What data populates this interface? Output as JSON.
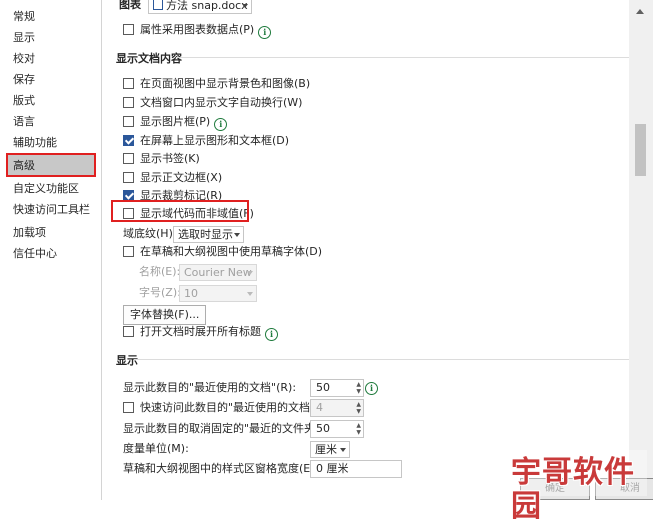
{
  "sidebar": {
    "items": [
      "常规",
      "显示",
      "校对",
      "保存",
      "版式",
      "语言",
      "辅助功能",
      "高级",
      "自定义功能区",
      "快速访问工具栏",
      "加载项",
      "信任中心"
    ],
    "selected": "高级"
  },
  "top": {
    "chart_label": "图表",
    "chart_doc": "方法 snap.docx",
    "attr_chart_points": "属性采用图表数据点(P)"
  },
  "doc_content": {
    "heading": "显示文档内容",
    "options": [
      {
        "label": "在页面视图中显示背景色和图像(B)",
        "checked": false
      },
      {
        "label": "文档窗口内显示文字自动换行(W)",
        "checked": false
      },
      {
        "label": "显示图片框(P)",
        "checked": false
      },
      {
        "label": "在屏幕上显示图形和文本框(D)",
        "checked": true
      },
      {
        "label": "显示书签(K)",
        "checked": false
      },
      {
        "label": "显示正文边框(X)",
        "checked": false
      },
      {
        "label": "显示裁剪标记(R)",
        "checked": true
      },
      {
        "label": "显示域代码而非域值(F)",
        "checked": false
      }
    ],
    "field_shading_label": "域底纹(H):",
    "field_shading_value": "选取时显示",
    "draft_font_label": "在草稿和大纲视图中使用草稿字体(D)",
    "name_label": "名称(E):",
    "name_value": "Courier New",
    "size_label": "字号(Z):",
    "size_value": "10",
    "font_sub_button": "字体替换(F)...",
    "expand_headings": "打开文档时展开所有标题"
  },
  "display": {
    "heading": "显示",
    "recent_docs_label": "显示此数目的\"最近使用的文档\"(R):",
    "recent_docs_value": "50",
    "quick_access_label": "快速访问此数目的\"最近使用的文档\"(Q):",
    "quick_access_value": "4",
    "unpinned_label": "显示此数目的取消固定的\"最近的文件夹\"(F):",
    "unpinned_value": "50",
    "unit_label": "度量单位(M):",
    "unit_value": "厘米",
    "style_width_label": "草稿和大纲视图中的样式区窗格宽度(E):",
    "style_width_value": "0 厘米"
  },
  "footer": {
    "ok": "确定",
    "cancel": "取消"
  },
  "watermark": "宇哥软件园",
  "colors": {
    "accent": "#2b579a",
    "highlight": "#e02020",
    "info": "#1e7a3c"
  }
}
